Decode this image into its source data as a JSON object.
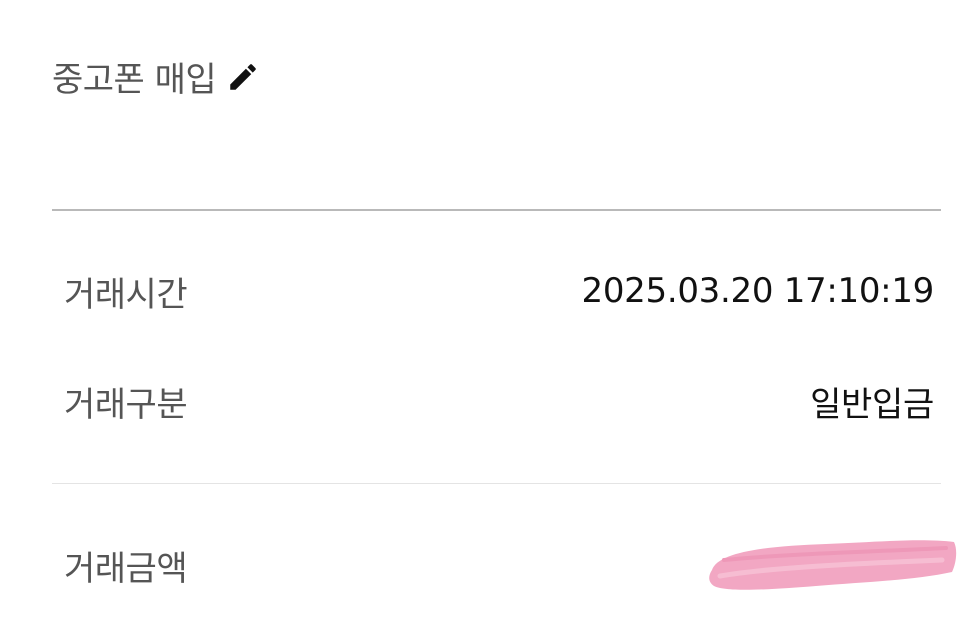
{
  "memo": {
    "label": "중고폰 매입",
    "edit_icon": "pencil-icon"
  },
  "details": {
    "time_label": "거래시간",
    "time_value": "2025.03.20 17:10:19",
    "type_label": "거래구분",
    "type_value": "일반입금",
    "amount_label": "거래금액",
    "amount_value": ""
  },
  "colors": {
    "label_text": "#555555",
    "value_text": "#111111",
    "divider": "#b9b9b9",
    "divider_light": "#e4e4e4",
    "redaction_pink": "#f2a7c3"
  }
}
